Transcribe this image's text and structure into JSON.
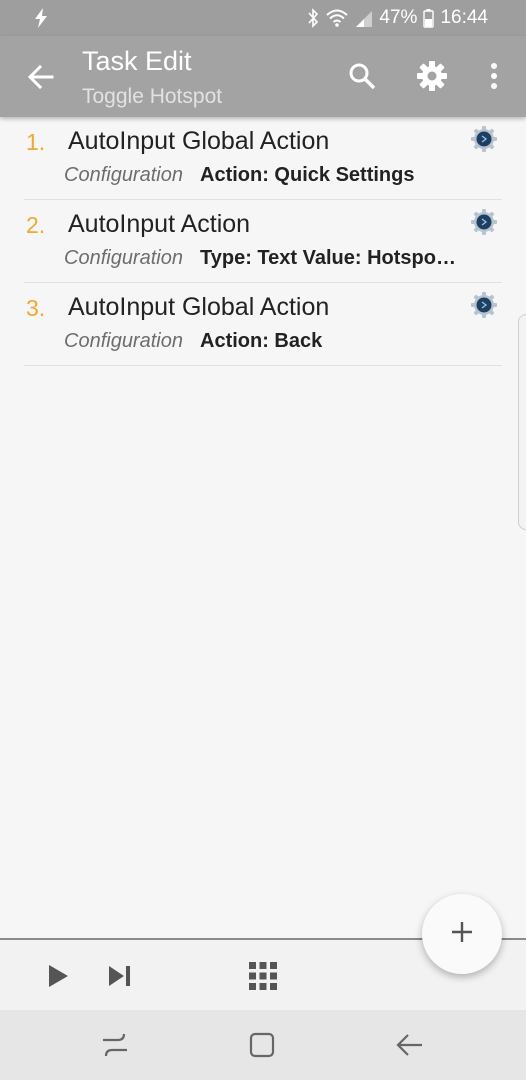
{
  "status_bar": {
    "battery": "47%",
    "time": "16:44",
    "icons": [
      "flash-icon",
      "bluetooth-icon",
      "wifi-icon",
      "signal-icon",
      "battery-icon"
    ]
  },
  "app_bar": {
    "title": "Task Edit",
    "subtitle": "Toggle Hotspot",
    "icons": [
      "back-arrow-icon",
      "search-icon",
      "gear-icon",
      "more-vert-icon"
    ]
  },
  "actions": [
    {
      "number": "1.",
      "name": "AutoInput Global Action",
      "config_label": "Configuration",
      "config_value": "Action: Quick Settings",
      "icon": "plugin-gear-icon"
    },
    {
      "number": "2.",
      "name": "AutoInput Action",
      "config_label": "Configuration",
      "config_value": "Type: Text Value: Hotspo…",
      "icon": "plugin-gear-icon"
    },
    {
      "number": "3.",
      "name": "AutoInput Global Action",
      "config_label": "Configuration",
      "config_value": "Action: Back",
      "icon": "plugin-gear-icon"
    }
  ],
  "bottom_bar": {
    "icons": [
      "play-icon",
      "skip-next-icon",
      "grid-icon"
    ]
  },
  "fab": {
    "icon": "plus-icon"
  },
  "nav_bar": {
    "icons": [
      "recents-icon",
      "home-icon",
      "back-icon"
    ]
  },
  "colors": {
    "app_bar": "#a3a3a3",
    "status_bar": "#9e9e9e",
    "number_accent": "#f0a830",
    "background": "#f6f6f6"
  }
}
